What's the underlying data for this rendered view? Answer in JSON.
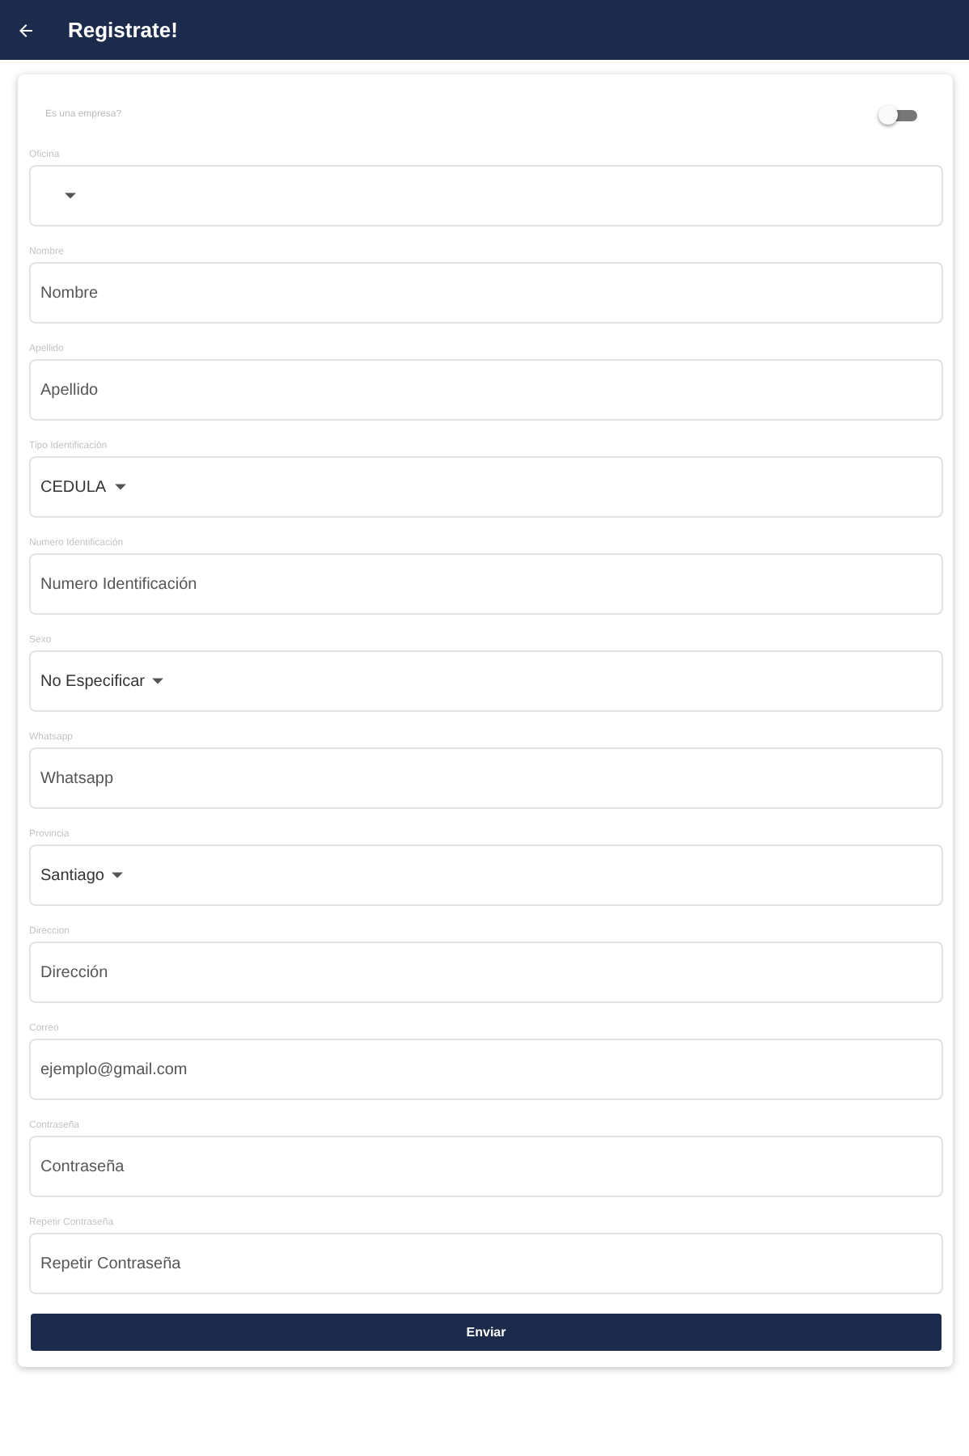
{
  "app_bar": {
    "title": "Registrate!"
  },
  "company_toggle": {
    "label": "Es una empresa?",
    "on": false
  },
  "fields": [
    {
      "kind": "select",
      "label": "Oficina"
    },
    {
      "kind": "input",
      "label": "Nombre",
      "placeholder": "Nombre"
    },
    {
      "kind": "input",
      "label": "Apellido",
      "placeholder": "Apellido"
    },
    {
      "kind": "select",
      "label": "Tipo Identificación",
      "value": "CEDULA"
    },
    {
      "kind": "input",
      "label": "Numero Identificación",
      "placeholder": "Numero Identificación"
    },
    {
      "kind": "select",
      "label": "Sexo",
      "value": "No Especificar"
    },
    {
      "kind": "input",
      "label": "Whatsapp",
      "placeholder": "Whatsapp"
    },
    {
      "kind": "select",
      "label": "Provincia",
      "value": "Santiago"
    },
    {
      "kind": "input",
      "label": "Direccion",
      "placeholder": "Dirección"
    },
    {
      "kind": "input",
      "label": "Correo",
      "placeholder": "ejemplo@gmail.com"
    },
    {
      "kind": "input",
      "label": "Contraseña",
      "placeholder": "Contraseña"
    },
    {
      "kind": "input",
      "label": "Repetir Contraseña",
      "placeholder": "Repetir Contraseña"
    }
  ],
  "submit_button": "Enviar"
}
